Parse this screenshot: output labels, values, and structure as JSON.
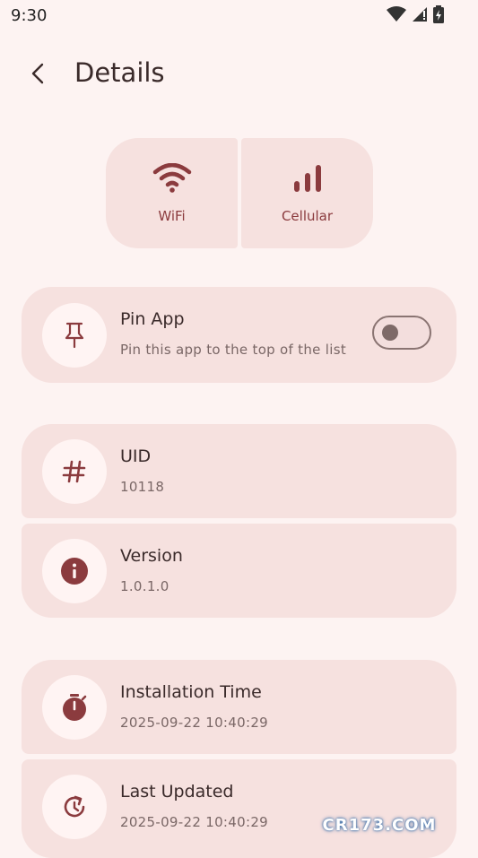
{
  "status": {
    "time": "9:30"
  },
  "header": {
    "title": "Details"
  },
  "network": {
    "wifi_label": "WiFi",
    "cellular_label": "Cellular"
  },
  "pin": {
    "title": "Pin App",
    "subtitle": "Pin this app to the top of the list",
    "enabled": false
  },
  "info": {
    "uid_title": "UID",
    "uid_value": "10118",
    "version_title": "Version",
    "version_value": "1.0.1.0"
  },
  "times": {
    "install_title": "Installation Time",
    "install_value": "2025-09-22 10:40:29",
    "updated_title": "Last Updated",
    "updated_value": "2025-09-22 10:40:29"
  },
  "watermark": {
    "text": "CR173.COM"
  },
  "colors": {
    "accent": "#8b3b3e",
    "surface": "#f6e1df",
    "background": "#fdf3f2"
  }
}
